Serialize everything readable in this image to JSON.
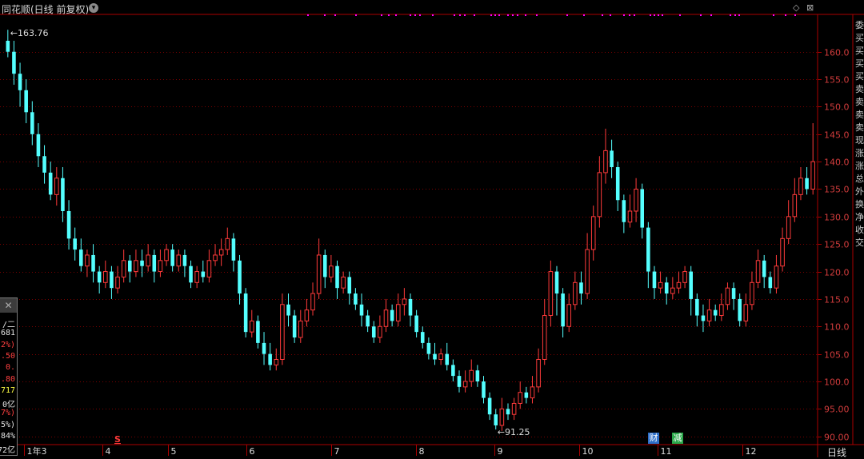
{
  "header": {
    "title": "同花顺(日线 前复权)",
    "menu_icon": "chevron-down-icon",
    "diamond_icon": "diamond-icon",
    "close_icon": "close-box-icon"
  },
  "colors": {
    "background": "#000000",
    "axis": "#aa0000",
    "grid": "#7a0000",
    "up": "#ff3a3a",
    "down": "#54ffff",
    "signal": "#ff00ff",
    "tick_text": "#d23c3c"
  },
  "annotations": {
    "high": "163.76",
    "low": "91.25",
    "s_marker": "S",
    "badge_cai": "财",
    "badge_jian": "减"
  },
  "period": "日线",
  "side_panel": {
    "close": "✕",
    "rows": [
      {
        "text": "/二",
        "color": "#e6e6e6"
      },
      {
        "text": "681",
        "color": "#e6e6e6"
      },
      {
        "text": "2%)",
        "color": "#ff4040"
      },
      {
        "text": ".50",
        "color": "#ff4040"
      },
      {
        "text": "0.",
        "color": "#ff4040"
      },
      {
        "text": ".80",
        "color": "#ff4040"
      },
      {
        "text": "717",
        "color": "#ffff44"
      },
      {
        "text": "0亿",
        "color": "#e6e6e6"
      },
      {
        "text": "7%)",
        "color": "#ff4040"
      },
      {
        "text": "5%)",
        "color": "#e6e6e6"
      },
      {
        "text": "84%",
        "color": "#e6e6e6"
      },
      {
        "text": "72亿",
        "color": "#e6e6e6"
      }
    ]
  },
  "right_indicators": [
    "委",
    "买",
    "买",
    "买",
    "买",
    "卖",
    "卖",
    "卖",
    "卖",
    "现",
    "涨",
    "涨",
    "总",
    "外",
    "换",
    "净",
    "收",
    "交"
  ],
  "chart_data": {
    "type": "candlestick",
    "yticks": [
      90.0,
      95.0,
      100.0,
      105.0,
      110.0,
      115.0,
      120.0,
      125.0,
      130.0,
      135.0,
      140.0,
      145.0,
      150.0,
      155.0,
      160.0
    ],
    "ylim": [
      88.5,
      166.8
    ],
    "xticks": [
      "1年3",
      "4",
      "5",
      "6",
      "7",
      "8",
      "9",
      "10",
      "11",
      "12"
    ],
    "grid": true,
    "candles": [
      [
        162,
        160,
        164,
        159
      ],
      [
        160,
        156,
        162,
        154
      ],
      [
        156,
        153,
        158,
        150
      ],
      [
        153,
        149,
        155,
        147
      ],
      [
        149,
        145,
        151,
        143
      ],
      [
        145,
        141,
        147,
        139
      ],
      [
        141,
        138,
        143,
        136
      ],
      [
        138,
        134,
        140,
        133
      ],
      [
        134,
        137,
        139,
        132
      ],
      [
        137,
        131,
        139,
        129
      ],
      [
        131,
        126,
        133,
        124
      ],
      [
        126,
        124,
        128,
        122
      ],
      [
        124,
        121,
        126,
        120
      ],
      [
        121,
        123,
        124,
        119
      ],
      [
        123,
        120,
        125,
        118
      ],
      [
        120,
        118,
        121,
        116
      ],
      [
        118,
        120,
        122,
        117
      ],
      [
        120,
        117,
        121,
        115
      ],
      [
        117,
        119,
        121,
        116
      ],
      [
        119,
        122,
        124,
        118
      ],
      [
        122,
        120,
        123,
        118
      ],
      [
        120,
        122,
        124,
        119
      ],
      [
        122,
        121,
        124,
        119
      ],
      [
        121,
        123,
        125,
        120
      ],
      [
        123,
        120,
        124,
        118
      ],
      [
        120,
        122,
        124,
        119
      ],
      [
        122,
        124,
        125,
        121
      ],
      [
        124,
        121,
        125,
        120
      ],
      [
        121,
        123,
        124,
        120
      ],
      [
        123,
        121,
        124,
        119
      ],
      [
        121,
        118,
        122,
        117
      ],
      [
        118,
        120,
        121,
        117
      ],
      [
        120,
        119,
        122,
        118
      ],
      [
        119,
        122,
        124,
        118
      ],
      [
        122,
        123,
        125,
        121
      ],
      [
        123,
        124,
        126,
        121
      ],
      [
        124,
        126,
        128,
        123
      ],
      [
        126,
        122,
        127,
        120
      ],
      [
        122,
        116,
        123,
        114
      ],
      [
        116,
        109,
        117,
        108
      ],
      [
        109,
        111,
        113,
        108
      ],
      [
        111,
        107,
        112,
        106
      ],
      [
        107,
        105,
        109,
        103
      ],
      [
        105,
        103,
        107,
        102
      ],
      [
        103,
        104,
        106,
        102
      ],
      [
        104,
        114,
        116,
        103
      ],
      [
        114,
        112,
        116,
        110
      ],
      [
        112,
        108,
        113,
        107
      ],
      [
        108,
        111,
        113,
        107
      ],
      [
        111,
        113,
        115,
        110
      ],
      [
        113,
        116,
        118,
        112
      ],
      [
        116,
        123,
        126,
        115
      ],
      [
        123,
        119,
        124,
        117
      ],
      [
        119,
        121,
        123,
        118
      ],
      [
        121,
        117,
        122,
        115
      ],
      [
        117,
        119,
        120,
        116
      ],
      [
        119,
        116,
        120,
        114
      ],
      [
        116,
        114,
        117,
        113
      ],
      [
        114,
        112,
        116,
        110
      ],
      [
        112,
        110,
        113,
        109
      ],
      [
        110,
        108,
        111,
        107
      ],
      [
        108,
        110,
        112,
        107
      ],
      [
        110,
        113,
        115,
        109
      ],
      [
        113,
        111,
        114,
        110
      ],
      [
        111,
        114,
        116,
        110
      ],
      [
        114,
        115,
        117,
        112
      ],
      [
        115,
        112,
        116,
        110
      ],
      [
        112,
        109,
        113,
        108
      ],
      [
        109,
        107,
        110,
        106
      ],
      [
        107,
        105,
        108,
        104
      ],
      [
        105,
        104,
        107,
        103
      ],
      [
        104,
        105,
        106,
        103
      ],
      [
        105,
        103,
        107,
        102
      ],
      [
        103,
        101,
        104,
        100
      ],
      [
        101,
        99,
        102,
        98
      ],
      [
        99,
        100,
        102,
        98
      ],
      [
        100,
        102,
        104,
        99
      ],
      [
        102,
        100,
        103,
        99
      ],
      [
        100,
        97,
        101,
        96
      ],
      [
        97,
        94,
        98,
        93
      ],
      [
        94,
        92,
        95,
        91.25
      ],
      [
        92,
        95,
        97,
        91
      ],
      [
        95,
        94,
        96,
        93
      ],
      [
        94,
        96,
        97,
        93
      ],
      [
        96,
        98,
        100,
        95
      ],
      [
        98,
        97,
        99,
        96
      ],
      [
        97,
        99,
        101,
        96
      ],
      [
        99,
        104,
        106,
        98
      ],
      [
        104,
        112,
        115,
        103
      ],
      [
        112,
        120,
        122,
        110
      ],
      [
        120,
        116,
        121,
        112
      ],
      [
        116,
        110,
        117,
        108
      ],
      [
        110,
        114,
        116,
        109
      ],
      [
        114,
        118,
        120,
        113
      ],
      [
        118,
        116,
        120,
        114
      ],
      [
        116,
        124,
        127,
        115
      ],
      [
        124,
        130,
        132,
        122
      ],
      [
        130,
        138,
        141,
        128
      ],
      [
        138,
        142,
        146,
        136
      ],
      [
        142,
        139,
        144,
        137
      ],
      [
        139,
        133,
        140,
        131
      ],
      [
        133,
        129,
        134,
        127
      ],
      [
        129,
        131,
        134,
        128
      ],
      [
        131,
        135,
        137,
        129
      ],
      [
        135,
        128,
        136,
        126
      ],
      [
        128,
        120,
        129,
        117
      ],
      [
        120,
        117,
        121,
        115
      ],
      [
        117,
        118,
        120,
        116
      ],
      [
        118,
        116,
        119,
        114
      ],
      [
        116,
        117,
        119,
        115
      ],
      [
        117,
        118,
        120,
        116
      ],
      [
        118,
        120,
        121,
        117
      ],
      [
        120,
        115,
        121,
        112
      ],
      [
        115,
        112,
        116,
        110
      ],
      [
        112,
        111,
        114,
        109
      ],
      [
        111,
        113,
        115,
        110
      ],
      [
        113,
        112,
        114,
        111
      ],
      [
        112,
        114,
        116,
        111
      ],
      [
        114,
        117,
        118,
        113
      ],
      [
        117,
        115,
        118,
        113
      ],
      [
        115,
        111,
        116,
        110
      ],
      [
        111,
        114,
        116,
        110
      ],
      [
        114,
        118,
        120,
        113
      ],
      [
        118,
        122,
        124,
        117
      ],
      [
        122,
        119,
        123,
        117
      ],
      [
        119,
        117,
        120,
        116
      ],
      [
        117,
        121,
        123,
        116
      ],
      [
        121,
        126,
        128,
        120
      ],
      [
        126,
        130,
        133,
        125
      ],
      [
        130,
        134,
        137,
        129
      ],
      [
        134,
        137,
        139,
        133
      ],
      [
        137,
        135,
        139,
        134
      ],
      [
        135,
        140,
        147,
        134
      ]
    ]
  }
}
